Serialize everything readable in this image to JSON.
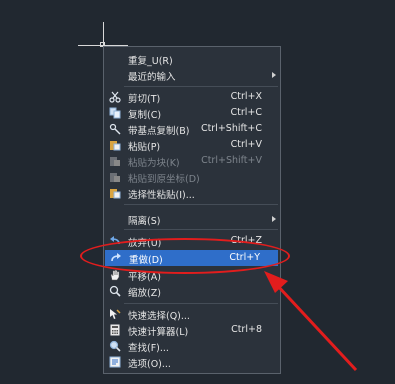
{
  "context_menu": {
    "items": [
      {
        "label": "重复_U(R)",
        "shortcut": "",
        "icon": "none"
      },
      {
        "label": "最近的输入",
        "shortcut": "",
        "icon": "none",
        "submenu": true
      },
      {
        "label": "剪切(T)",
        "shortcut": "Ctrl+X",
        "icon": "scissors-icon"
      },
      {
        "label": "复制(C)",
        "shortcut": "Ctrl+C",
        "icon": "copy-icon"
      },
      {
        "label": "带基点复制(B)",
        "shortcut": "Ctrl+Shift+C",
        "icon": "copy-base-point-icon"
      },
      {
        "label": "粘贴(P)",
        "shortcut": "Ctrl+V",
        "icon": "paste-icon"
      },
      {
        "label": "粘贴为块(K)",
        "shortcut": "Ctrl+Shift+V",
        "icon": "paste-block-icon",
        "disabled": true
      },
      {
        "label": "粘贴到原坐标(D)",
        "shortcut": "",
        "icon": "paste-original-icon",
        "disabled": true
      },
      {
        "label": "选择性粘贴(I)...",
        "shortcut": "",
        "icon": "paste-special-icon"
      },
      {
        "label": "隔离(S)",
        "shortcut": "",
        "icon": "none",
        "submenu": true
      },
      {
        "label": "放弃(U)",
        "shortcut": "Ctrl+Z",
        "icon": "undo-icon"
      },
      {
        "label": "重做(D)",
        "shortcut": "Ctrl+Y",
        "icon": "redo-icon",
        "highlighted": true
      },
      {
        "label": "平移(A)",
        "shortcut": "",
        "icon": "pan-hand-icon"
      },
      {
        "label": "缩放(Z)",
        "shortcut": "",
        "icon": "zoom-icon"
      },
      {
        "label": "快速选择(Q)...",
        "shortcut": "",
        "icon": "quick-select-icon"
      },
      {
        "label": "快速计算器(L)",
        "shortcut": "Ctrl+8",
        "icon": "calculator-icon"
      },
      {
        "label": "查找(F)...",
        "shortcut": "",
        "icon": "find-icon"
      },
      {
        "label": "选项(O)...",
        "shortcut": "",
        "icon": "options-icon"
      }
    ]
  },
  "annotation_color": "#e21d1d",
  "highlight_color": "#2f6ec9"
}
